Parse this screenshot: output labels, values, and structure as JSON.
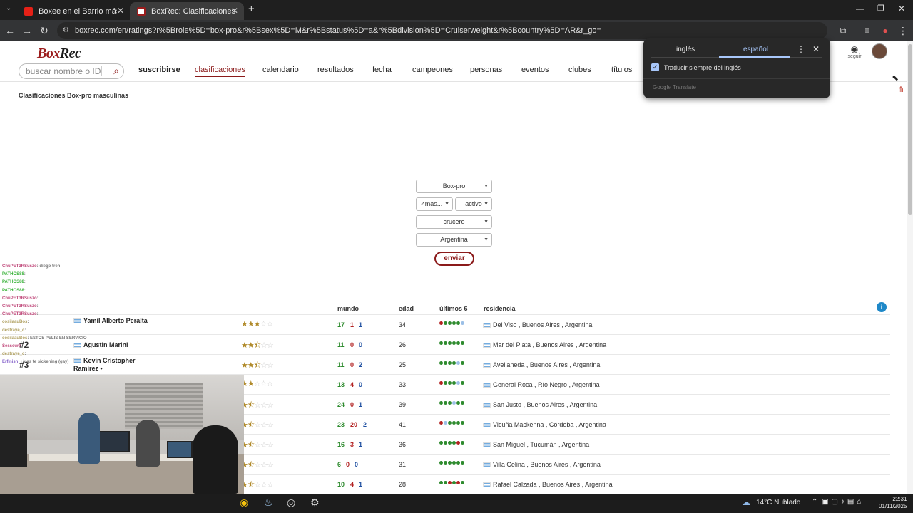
{
  "browser": {
    "tabs": [
      {
        "title": "Boxee en el Barrio más Peligros",
        "active": false
      },
      {
        "title": "BoxRec: Clasificaciones",
        "active": true
      }
    ],
    "new_tab": "+",
    "url": "boxrec.com/en/ratings?r%5Brole%5D=box-pro&r%5Bsex%5D=M&r%5Bstatus%5D=a&r%5Bdivision%5D=Cruiserweight&r%5Bcountry%5D=AR&r_go="
  },
  "site": {
    "logo_a": "Box",
    "logo_b": "Rec",
    "search_placeholder": "buscar nombre o ID",
    "nav": [
      "suscribirse",
      "clasificaciones",
      "calendario",
      "resultados",
      "fecha",
      "campeones",
      "personas",
      "eventos",
      "clubes",
      "títulos"
    ],
    "follow_label": "seguir",
    "page_title": "Clasificaciones Box-pro masculinas"
  },
  "filters": {
    "role": "Box-pro",
    "sex": "♂mas...",
    "status": "activo",
    "division": "crucero",
    "country": "Argentina",
    "submit": "enviar"
  },
  "table": {
    "headers": {
      "world": "mundo",
      "age": "edad",
      "last6": "últimos 6",
      "residence": "residencia"
    },
    "rows": [
      {
        "rank": "",
        "name": "Yamil Alberto Peralta",
        "stars": 3,
        "w": "17",
        "l": "1",
        "d": "1",
        "age": "34",
        "last6": [
          "l",
          "w",
          "w",
          "w",
          "w",
          "d"
        ],
        "res": "Del Viso , Buenos Aires , Argentina"
      },
      {
        "rank": "#2",
        "name": "Agustin Marini",
        "stars": 2.5,
        "w": "11",
        "l": "0",
        "d": "0",
        "age": "26",
        "last6": [
          "w",
          "w",
          "w",
          "w",
          "w",
          "w"
        ],
        "res": "Mar del Plata , Buenos Aires , Argentina"
      },
      {
        "rank": "#3",
        "name": "Kevin Cristopher Ramirez •",
        "stars": 2.5,
        "w": "11",
        "l": "0",
        "d": "2",
        "age": "25",
        "last6": [
          "w",
          "w",
          "w",
          "w",
          "d",
          "w"
        ],
        "res": "Avellaneda , Buenos Aires , Argentina"
      },
      {
        "rank": "",
        "name": "",
        "stars": 2,
        "w": "13",
        "l": "4",
        "d": "0",
        "age": "33",
        "last6": [
          "l",
          "w",
          "w",
          "w",
          "d",
          "w"
        ],
        "res": "General Roca , Río Negro , Argentina"
      },
      {
        "rank": "",
        "name": "",
        "stars": 1.5,
        "w": "24",
        "l": "0",
        "d": "1",
        "age": "39",
        "last6": [
          "w",
          "w",
          "w",
          "d",
          "w",
          "w"
        ],
        "res": "San Justo , Buenos Aires , Argentina"
      },
      {
        "rank": "",
        "name": "",
        "stars": 1.5,
        "w": "23",
        "l": "20",
        "d": "2",
        "age": "41",
        "last6": [
          "l",
          "d",
          "w",
          "w",
          "w",
          "w"
        ],
        "res": "Vicuña Mackenna , Córdoba , Argentina"
      },
      {
        "rank": "",
        "name": "",
        "stars": 1.5,
        "w": "16",
        "l": "3",
        "d": "1",
        "age": "36",
        "last6": [
          "w",
          "w",
          "w",
          "w",
          "l",
          "w"
        ],
        "res": "San Miguel , Tucumán , Argentina"
      },
      {
        "rank": "",
        "name": "",
        "stars": 1.5,
        "w": "6",
        "l": "0",
        "d": "0",
        "age": "31",
        "last6": [
          "w",
          "w",
          "w",
          "w",
          "w",
          "w"
        ],
        "res": "Villa Celina , Buenos Aires , Argentina"
      },
      {
        "rank": "",
        "name": "",
        "stars": 1.5,
        "w": "10",
        "l": "4",
        "d": "1",
        "age": "28",
        "last6": [
          "w",
          "w",
          "l",
          "w",
          "l",
          "w"
        ],
        "res": "Rafael Calzada , Buenos Aires , Argentina"
      }
    ]
  },
  "translate_popup": {
    "lang_from": "inglés",
    "lang_to": "español",
    "always_translate": "Traducir siempre del inglés",
    "footer": "Google Translate"
  },
  "chat": [
    {
      "user": "ChuPET3RSuszo",
      "msg": ": diego tren",
      "color": "#c0487a"
    },
    {
      "user": "PATHOS88",
      "msg": ":",
      "color": "#3bb33b"
    },
    {
      "user": "PATHOS88",
      "msg": ":",
      "color": "#3bb33b"
    },
    {
      "user": "PATHOS88",
      "msg": ":",
      "color": "#3bb33b"
    },
    {
      "user": "ChuPET3RSuszo",
      "msg": ":",
      "color": "#c0487a"
    },
    {
      "user": "ChuPET3RSuszo",
      "msg": ":",
      "color": "#c0487a"
    },
    {
      "user": "ChuPET3RSuszo",
      "msg": ":",
      "color": "#c0487a"
    },
    {
      "user": "cosilaauBos",
      "msg": ":",
      "color": "#b0a060"
    },
    {
      "user": "destraye_c",
      "msg": ":",
      "color": "#b0a060"
    },
    {
      "user": "cosilaauBos",
      "msg": ": ESTOS PELIS EN SERVICIO",
      "color": "#b0a060"
    },
    {
      "user": "Sessow0",
      "msg": ":",
      "color": "#c0487a"
    },
    {
      "user": "destraye_c",
      "msg": ":",
      "color": "#b0a060"
    },
    {
      "user": "Erfinish_",
      "msg": ": kiss te sickening (gay)",
      "color": "#8866cc"
    }
  ],
  "taskbar": {
    "weather": "14°C  Nublado",
    "time": "22:31",
    "date": "01/11/2025"
  },
  "colors": {
    "brand": "#8b1a1a",
    "win": "#2e8b2e",
    "loss": "#b22222",
    "draw": "#1e4fa0"
  }
}
